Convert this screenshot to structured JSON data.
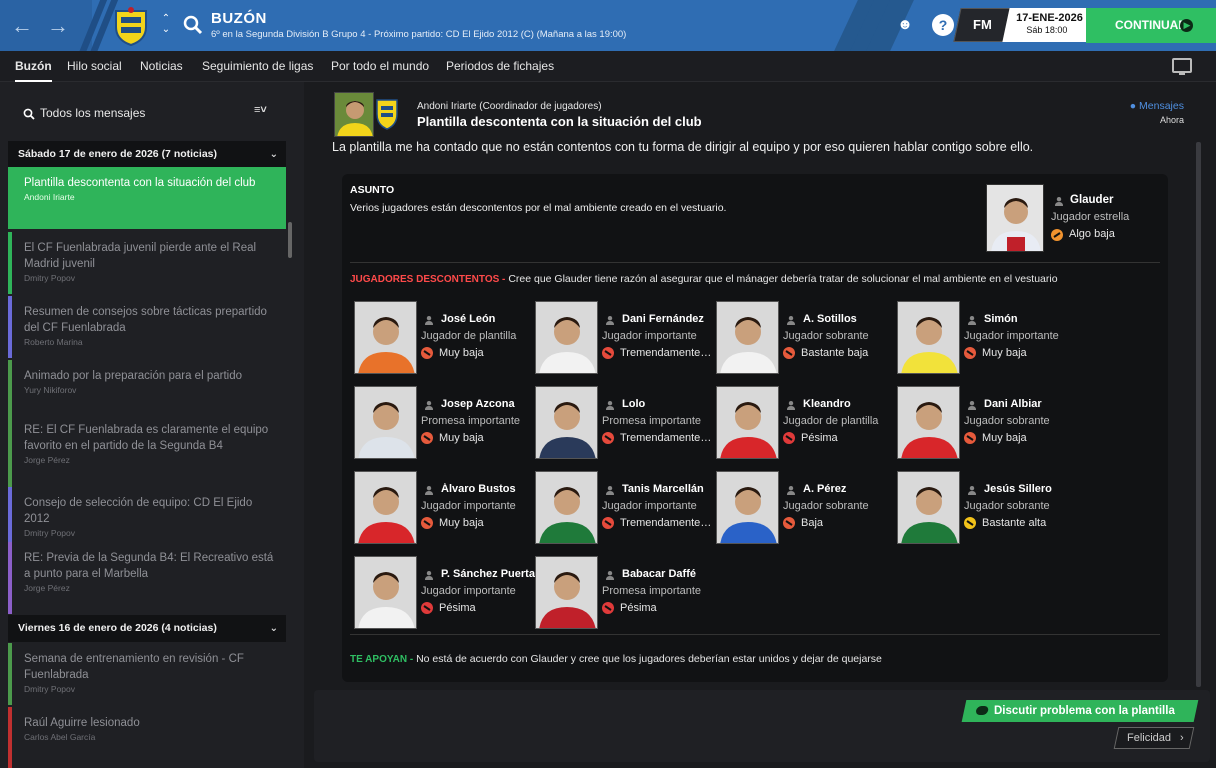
{
  "topbar": {
    "title": "BUZÓN",
    "subtitle": "6º en la Segunda División B Grupo 4 - Próximo partido: CD El Ejido 2012 (C)  (Mañana a las 19:00)",
    "fm_label": "FM",
    "date": "17-ENE-2026",
    "time": "Sáb 18:00",
    "continue_label": "CONTINUAR",
    "help_label": "?"
  },
  "tabs": [
    "Buzón",
    "Hilo social",
    "Noticias",
    "Seguimiento de ligas",
    "Por todo el mundo",
    "Periodos de fichajes"
  ],
  "sidebar": {
    "filter_label": "Todos los mensajes",
    "groups": [
      {
        "title": "Sábado 17 de enero de 2026 (7 noticias)"
      },
      {
        "title": "Viernes 16 de enero de 2026 (4 noticias)"
      }
    ],
    "messages": [
      {
        "title": "Plantilla descontenta con la situación del club",
        "author": "Andoni Iriarte",
        "color": "#2fb45a"
      },
      {
        "title": "El CF Fuenlabrada juvenil pierde ante el Real Madrid juvenil",
        "author": "Dmitry Popov",
        "color": "#2fb45a"
      },
      {
        "title": "Resumen de consejos sobre tácticas prepartido del CF Fuenlabrada",
        "author": "Roberto Marina",
        "color": "#6a6ad8"
      },
      {
        "title": "Animado por la preparación para el partido",
        "author": "Yury Nikiforov",
        "color": "#4c9a4c"
      },
      {
        "title": "RE: El CF Fuenlabrada es claramente el equipo favorito en el partido de la Segunda B4",
        "author": "Jorge Pérez",
        "color": "#4c9a4c"
      },
      {
        "title": "Consejo de selección de equipo: CD El Ejido 2012",
        "author": "Dmitry Popov",
        "color": "#6a6ad8"
      },
      {
        "title": "RE: Previa de la Segunda B4: El Recreativo está a punto para el Marbella",
        "author": "Jorge Pérez",
        "color": "#8c5fc9"
      },
      {
        "title": "Semana de entrenamiento en revisión - CF Fuenlabrada",
        "author": "Dmitry Popov",
        "color": "#4c9a4c"
      },
      {
        "title": "Raúl Aguirre lesionado",
        "author": "Carlos Abel García",
        "color": "#c03030"
      }
    ]
  },
  "message": {
    "sender": "Andoni Iriarte (Coordinador de jugadores)",
    "title": "Plantilla descontenta con la situación del club",
    "link": "Mensajes",
    "time": "Ahora",
    "body": "La plantilla me ha contado que no están contentos con tu forma de dirigir al equipo y por eso quieren hablar contigo sobre ello.",
    "asunto_title": "ASUNTO",
    "asunto_text": "Verios jugadores están descontentos por el mal ambiente creado en el vestuario.",
    "star": {
      "name": "Glauder",
      "role": "Jugador estrella",
      "mood": "Algo baja",
      "mood_color": "#f0922e"
    },
    "discontent_label": "JUGADORES DESCONTENTOS -",
    "discontent_text": "Cree que Glauder tiene razón al asegurar que el mánager debería tratar de solucionar el mal ambiente en el vestuario",
    "support_label": "TE APOYAN -",
    "support_text": "No está de acuerdo con Glauder y cree que los jugadores deberían estar unidos y dejar de quejarse",
    "players": [
      {
        "name": "José León",
        "role": "Jugador de plantilla",
        "mood": "Muy baja",
        "mood_color": "#e65a3c",
        "kit": "#e8722a"
      },
      {
        "name": "Dani Fernández",
        "role": "Jugador importante",
        "mood": "Tremendamente baja",
        "mood_color": "#e64a3c",
        "kit": "#f2f2f2"
      },
      {
        "name": "A. Sotillos",
        "role": "Jugador sobrante",
        "mood": "Bastante baja",
        "mood_color": "#e65a3c",
        "kit": "#f2f2f2"
      },
      {
        "name": "Simón",
        "role": "Jugador importante",
        "mood": "Muy baja",
        "mood_color": "#e65a3c",
        "kit": "#f2e23a"
      },
      {
        "name": "Josep Azcona",
        "role": "Promesa importante",
        "mood": "Muy baja",
        "mood_color": "#e65a3c",
        "kit": "#dde3ea"
      },
      {
        "name": "Lolo",
        "role": "Promesa importante",
        "mood": "Tremendamente baja",
        "mood_color": "#e64a3c",
        "kit": "#2a3a5a"
      },
      {
        "name": "Kleandro",
        "role": "Jugador de plantilla",
        "mood": "Pésima",
        "mood_color": "#e03a3a",
        "kit": "#d8262a"
      },
      {
        "name": "Dani Albiar",
        "role": "Jugador sobrante",
        "mood": "Muy baja",
        "mood_color": "#e65a3c",
        "kit": "#d8262a"
      },
      {
        "name": "Álvaro Bustos",
        "role": "Jugador importante",
        "mood": "Muy baja",
        "mood_color": "#e65a3c",
        "kit": "#d8262a"
      },
      {
        "name": "Tanis Marcellán",
        "role": "Jugador importante",
        "mood": "Tremendamente baja",
        "mood_color": "#e64a3c",
        "kit": "#1f7a3a"
      },
      {
        "name": "A. Pérez",
        "role": "Jugador sobrante",
        "mood": "Baja",
        "mood_color": "#e65a3c",
        "kit": "#2a62c8"
      },
      {
        "name": "Jesús Sillero",
        "role": "Jugador sobrante",
        "mood": "Bastante alta",
        "mood_color": "#f2c21a",
        "kit": "#1f7a3a"
      },
      {
        "name": "P. Sánchez Puerta",
        "role": "Jugador importante",
        "mood": "Pésima",
        "mood_color": "#e03a3a",
        "kit": "#f2f2f2"
      },
      {
        "name": "Babacar Daffé",
        "role": "Promesa importante",
        "mood": "Pésima",
        "mood_color": "#e03a3a",
        "kit": "#c0202a"
      }
    ]
  },
  "actions": {
    "discuss_label": "Discutir problema con la plantilla",
    "happiness_label": "Felicidad"
  }
}
